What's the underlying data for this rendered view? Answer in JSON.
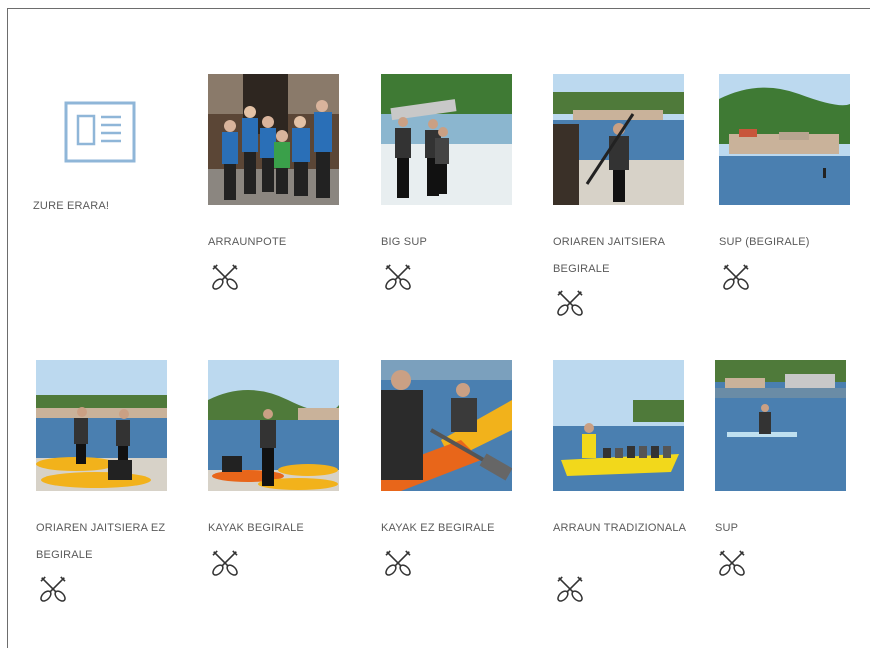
{
  "featured": {
    "icon": "card-icon",
    "label": "ZURE ERARA!"
  },
  "activities": [
    {
      "title": "ARRAUNPOTE",
      "icon": "crossed-paddles-icon"
    },
    {
      "title": "BIG SUP",
      "icon": "crossed-paddles-icon"
    },
    {
      "title": "ORIAREN JAITSIERA BEGIRALE",
      "icon": "crossed-paddles-icon"
    },
    {
      "title": "SUP (BEGIRALE)",
      "icon": "crossed-paddles-icon"
    },
    {
      "title": "ORIAREN JAITSIERA EZ BEGIRALE",
      "icon": "crossed-paddles-icon"
    },
    {
      "title": "KAYAK BEGIRALE",
      "icon": "crossed-paddles-icon"
    },
    {
      "title": "KAYAK EZ BEGIRALE",
      "icon": "crossed-paddles-icon"
    },
    {
      "title": "ARRAUN TRADIZIONALA",
      "icon": "crossed-paddles-icon"
    },
    {
      "title": "SUP",
      "icon": "crossed-paddles-icon"
    }
  ],
  "colors": {
    "icon_blue": "#8fb6d8",
    "text": "#5a5a5a",
    "kayak_yellow": "#f2b21b",
    "water": "#4a7fb0",
    "sky": "#bcd9ef",
    "hill": "#4f7a3a",
    "jacket_blue": "#2a6fb7"
  }
}
